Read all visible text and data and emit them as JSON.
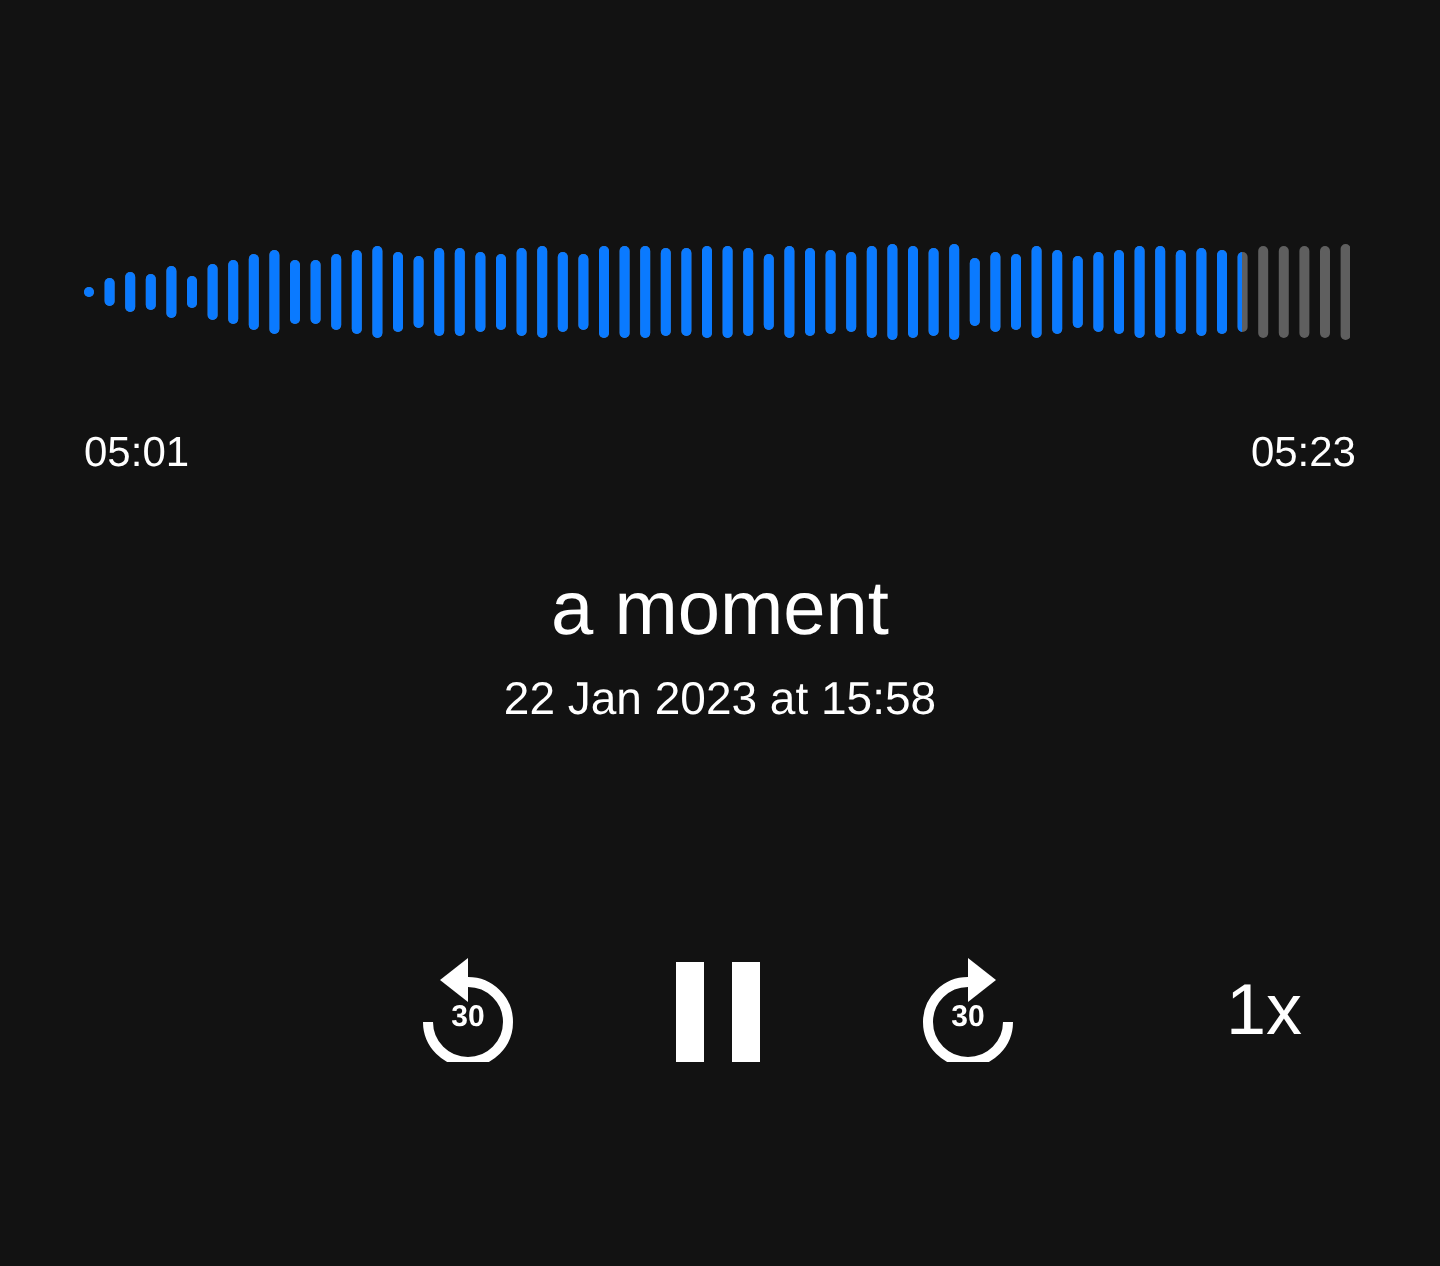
{
  "waveform": {
    "level": 0.914
  },
  "elapsed": "05:01",
  "duration": "05:23",
  "title": "a moment",
  "date": "22 Jan 2023 at 15:58",
  "controls": [
    {
      "kind": "back",
      "label": "30"
    },
    {
      "kind": "pause"
    },
    {
      "kind": "forward",
      "label": "30"
    },
    {
      "kind": "speed",
      "label": "1x"
    }
  ]
}
